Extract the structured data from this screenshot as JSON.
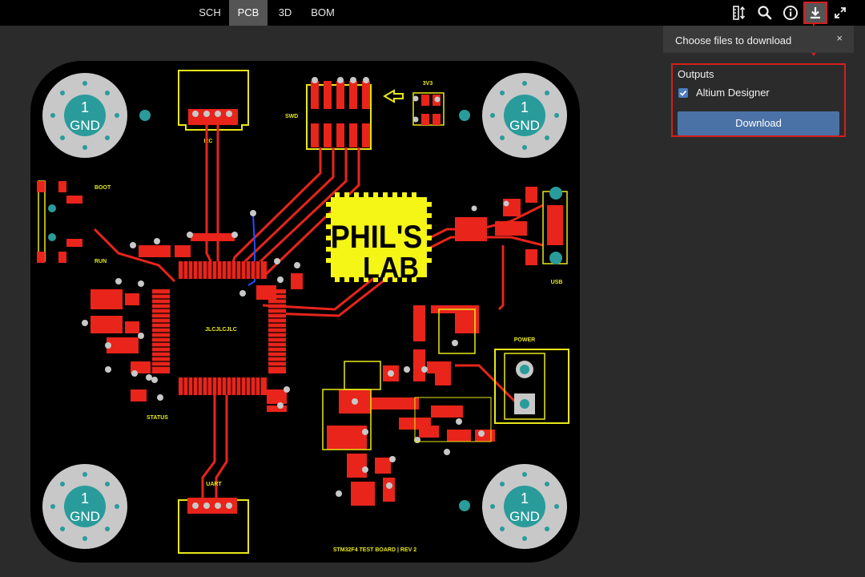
{
  "tabs": [
    {
      "label": "SCH",
      "active": false
    },
    {
      "label": "PCB",
      "active": true
    },
    {
      "label": "3D",
      "active": false
    },
    {
      "label": "BOM",
      "active": false
    }
  ],
  "toolbar_icons": [
    "measure-icon",
    "search-icon",
    "info-icon",
    "download-icon",
    "fullscreen-icon"
  ],
  "download_panel": {
    "title": "Choose files to download",
    "close": "×",
    "outputs_title": "Outputs",
    "checkbox_label": "Altium Designer",
    "checkbox_checked": true,
    "button_label": "Download"
  },
  "board": {
    "mounting_hole_number": "1",
    "mounting_hole_label": "GND",
    "logo_line1": "PHIL'S",
    "logo_line2": "LAB",
    "silk_labels": {
      "i2c": "I2C",
      "swd": "SWD",
      "v33": "3V3",
      "boot": "BOOT",
      "run": "RUN",
      "mcu": "JLCJLCJLC",
      "status": "STATUS",
      "usb": "USB",
      "power": "POWER",
      "uart": "UART",
      "footer": "STM32F4 TEST BOARD | REV 2"
    }
  },
  "colors": {
    "copper": "#e8241b",
    "silkscreen": "#e8e81a",
    "board": "#000000",
    "hole_pad": "#c8c8c8",
    "hole_center": "#2a9b9b",
    "accent": "#4b72a6",
    "highlight": "#d21f1f"
  }
}
